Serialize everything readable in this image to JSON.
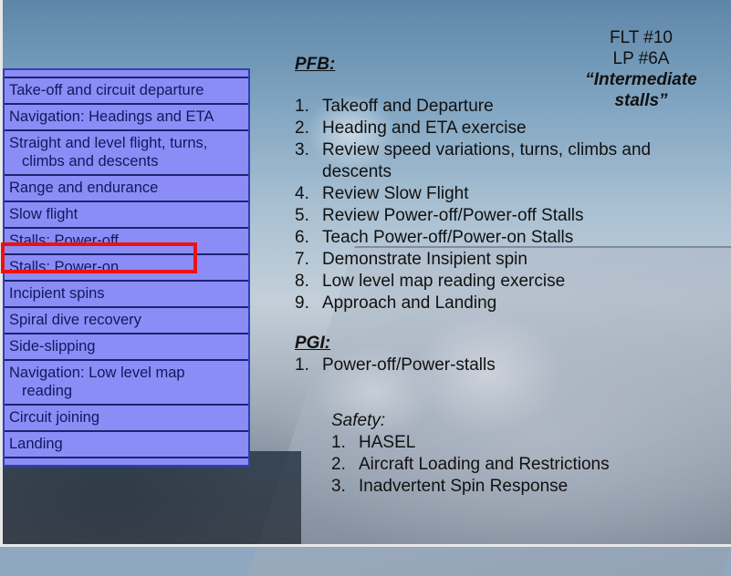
{
  "menu": {
    "items": [
      {
        "label": "Take-off and circuit departure"
      },
      {
        "label": "Navigation:  Headings and ETA"
      },
      {
        "label": "Straight and level flight, turns,",
        "label2": "climbs and descents"
      },
      {
        "label": "Range and endurance"
      },
      {
        "label": "Slow flight"
      },
      {
        "label": "Stalls:  Power-off"
      },
      {
        "label": "Stalls:  Power-on",
        "selected": true
      },
      {
        "label": "Incipient spins"
      },
      {
        "label": "Spiral dive recovery"
      },
      {
        "label": "Side-slipping"
      },
      {
        "label": "Navigation:  Low level map",
        "label2": "reading"
      },
      {
        "label": "Circuit joining"
      },
      {
        "label": "Landing"
      }
    ],
    "colors": {
      "background": "#8c8cf7",
      "highlight": "#ee1111",
      "text": "#0e1a5c"
    }
  },
  "flight": {
    "flt": "FLT #10",
    "lp": "LP #6A",
    "title_line1": "“Intermediate",
    "title_line2": "stalls”"
  },
  "pfb": {
    "heading": "PFB:",
    "items": [
      {
        "num": "1.",
        "text": "Takeoff and Departure"
      },
      {
        "num": "2.",
        "text": "Heading and ETA exercise"
      },
      {
        "num": "3.",
        "text": "Review speed variations, turns, climbs and descents"
      },
      {
        "num": "4.",
        "text": "Review Slow Flight"
      },
      {
        "num": "5.",
        "text": "Review Power-off/Power-off Stalls"
      },
      {
        "num": "6.",
        "text": "Teach Power-off/Power-on Stalls"
      },
      {
        "num": "7.",
        "text": "Demonstrate Insipient spin"
      },
      {
        "num": "8.",
        "text": "Low level map reading exercise"
      },
      {
        "num": "9.",
        "text": "Approach and Landing"
      }
    ]
  },
  "pgi": {
    "heading": "PGI:",
    "items": [
      {
        "num": "1.",
        "text": "Power-off/Power-stalls"
      }
    ]
  },
  "safety": {
    "label": "Safety:",
    "items": [
      {
        "num": "1.",
        "text": "HASEL"
      },
      {
        "num": "2.",
        "text": "Aircraft Loading and Restrictions"
      },
      {
        "num": "3.",
        "text": "Inadvertent Spin Response"
      }
    ]
  }
}
